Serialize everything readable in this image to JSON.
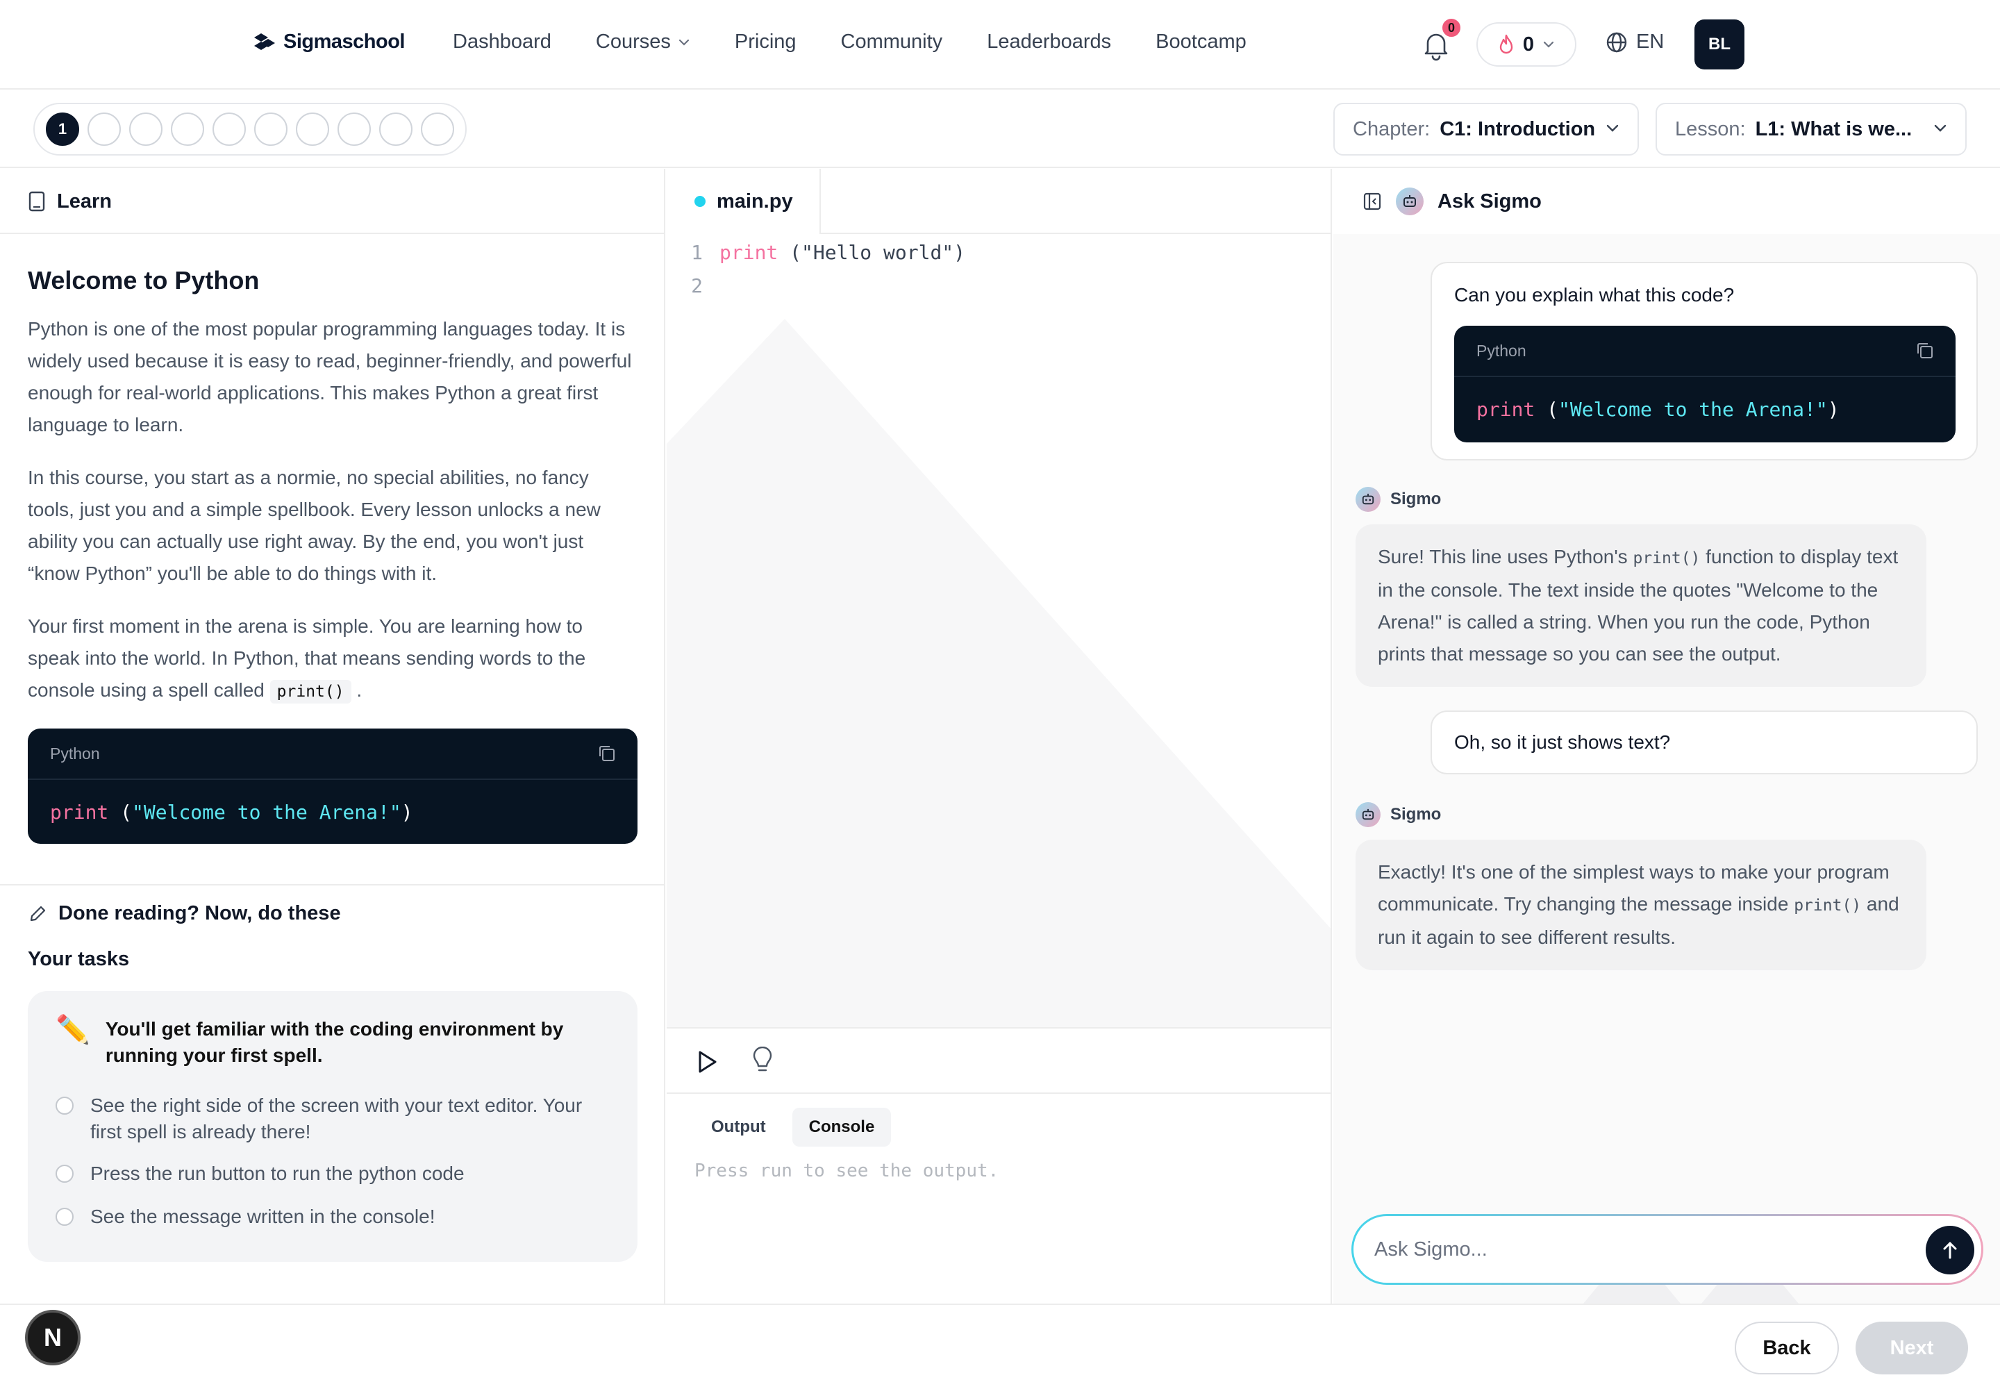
{
  "nav": {
    "logo": "Sigmaschool",
    "links": [
      "Dashboard",
      "Courses",
      "Pricing",
      "Community",
      "Leaderboards",
      "Bootcamp"
    ],
    "notification_count": "0",
    "streak_count": "0",
    "language": "EN",
    "avatar_initials": "BL"
  },
  "progress": {
    "current_step": "1",
    "total_steps": 10
  },
  "chapter": {
    "label": "Chapter:",
    "value": "C1: Introduction"
  },
  "lesson_select": {
    "label": "Lesson:",
    "value": "L1: What is we..."
  },
  "learn": {
    "tab_label": "Learn",
    "title": "Welcome to Python",
    "paragraph1": "Python is one of the most popular programming languages today. It is widely used because it is easy to read, beginner-friendly, and powerful enough for real-world applications. This makes Python a great first language to learn.",
    "paragraph2": "In this course, you start as a normie, no special abilities, no fancy tools, just you and a simple spellbook. Every lesson unlocks a new ability you can actually use right away. By the end, you won't just “know Python” you'll be able to do things with it.",
    "paragraph3": "Your first moment in the arena is simple. You are learning how to speak into the world. In Python, that means sending words to the console using a spell called",
    "paragraph3_code": "print()",
    "paragraph3_end": ".",
    "code_lang": "Python",
    "code_kw": "print",
    "code_open": " (",
    "code_str": "\"Welcome to the Arena!\"",
    "code_close": ")"
  },
  "tasks": {
    "heading": "Done reading? Now, do these",
    "subheading": "Your tasks",
    "card_emoji": "✏️",
    "card_title": "You'll get familiar with the coding environment by running your first spell.",
    "items": [
      "See the right side of the screen with your text editor. Your first spell is already there!",
      "Press the run button to run the python code",
      "See the message written in the console!"
    ]
  },
  "editor": {
    "file_name": "main.py",
    "line1_num": "1",
    "line2_num": "2",
    "line1_kw": "print",
    "line1_rest": " (\"Hello world\")"
  },
  "output": {
    "tabs": [
      "Output",
      "Console"
    ],
    "active_tab": "Console",
    "placeholder": "Press run to see the output."
  },
  "chat": {
    "title": "Ask Sigmo",
    "bot_name": "Sigmo",
    "msg1": "Can you explain what this code?",
    "msg1_code_lang": "Python",
    "msg1_code_kw": "print",
    "msg1_code_open": " (",
    "msg1_code_str": "\"Welcome to the Arena!\"",
    "msg1_code_close": ")",
    "reply1_a": "Sure! This line uses Python's ",
    "reply1_code": "print()",
    "reply1_b": " function to display text in the console. The text inside the quotes \"Welcome to the Arena!\" is called a string. When you run the code, Python prints that message so you can see the output.",
    "msg2": "Oh, so it just shows text?",
    "reply2_a": "Exactly! It's one of the simplest ways to make your program communicate. Try changing the message inside ",
    "reply2_code": "print()",
    "reply2_b": " and run it again to see different results.",
    "input_placeholder": "Ask Sigmo..."
  },
  "footer": {
    "badge": "N",
    "back": "Back",
    "next": "Next"
  },
  "colors": {
    "accent_dark": "#0b1628",
    "code_bg": "#071422",
    "keyword": "#f472a0",
    "string": "#5ee7f2",
    "notification_badge": "#f0597a"
  }
}
